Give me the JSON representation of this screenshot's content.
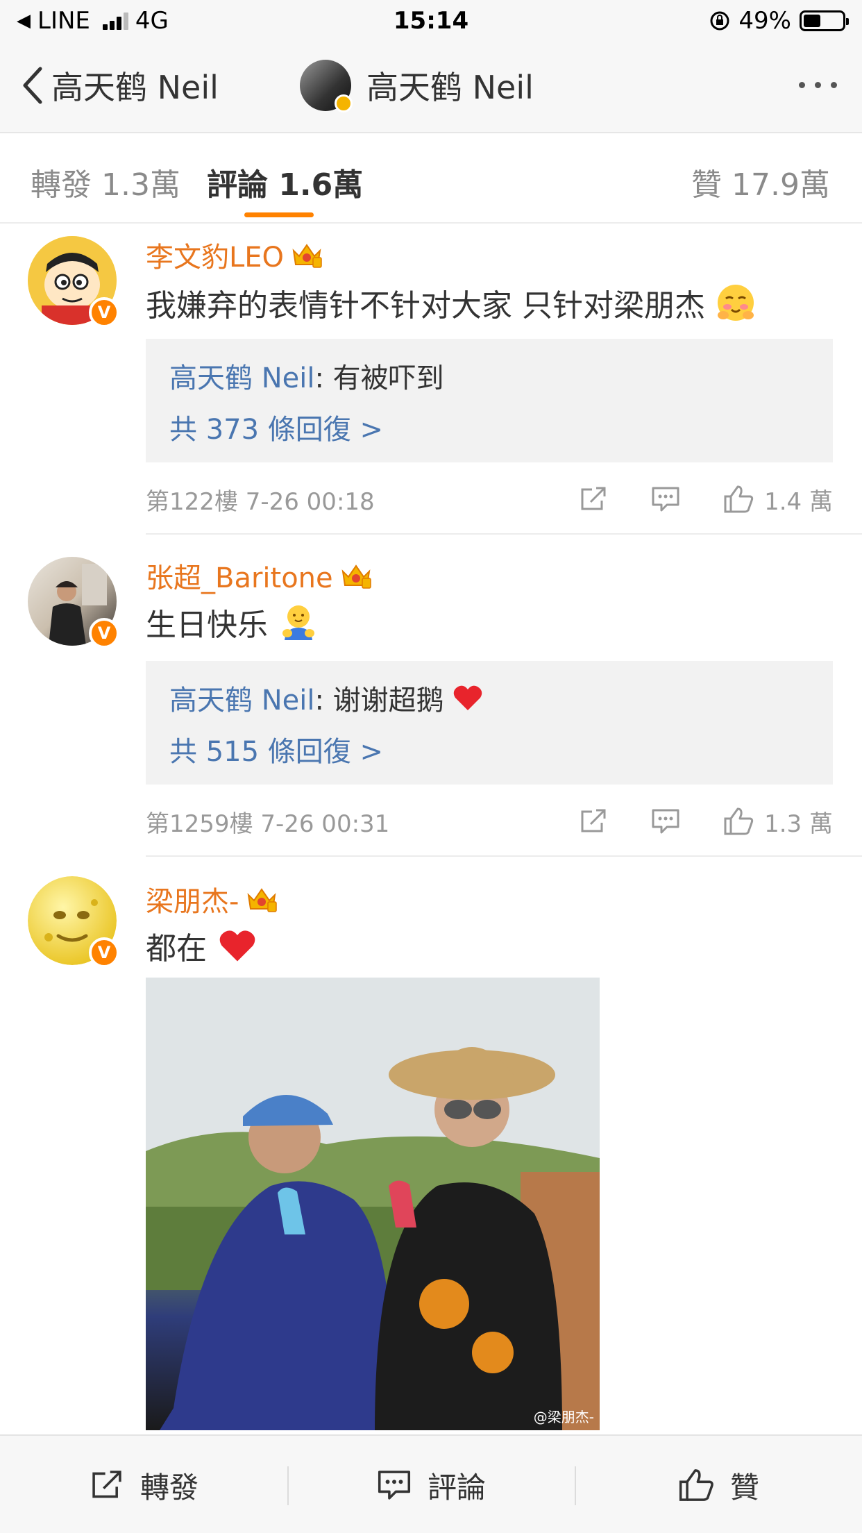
{
  "status_bar": {
    "carrier": "LINE",
    "network": "4G",
    "time": "15:14",
    "battery": "49%"
  },
  "nav": {
    "back_label": "高天鹤 Neil",
    "title": "高天鹤 Neil"
  },
  "tabs": {
    "repost": "轉發 1.3萬",
    "comments": "評論 1.6萬",
    "likes": "贊 17.9萬"
  },
  "comments": [
    {
      "user": "李文豹LEO",
      "text": "我嫌弃的表情针不针对大家 只针对梁朋杰",
      "reply_author": "高天鹤 Neil",
      "reply_text": ": 有被吓到",
      "reply_more": "共 373 條回復 >",
      "floor": "第122樓 7-26 00:18",
      "likes": "1.4 萬"
    },
    {
      "user": "张超_Baritone",
      "text": "生日快乐",
      "reply_author": "高天鹤 Neil",
      "reply_text": ": 谢谢超鹅",
      "reply_more": "共 515 條回復 >",
      "floor": "第1259樓 7-26 00:31",
      "likes": "1.3 萬"
    },
    {
      "user": "梁朋杰-",
      "text": "都在",
      "watermark": "@梁朋杰-"
    }
  ],
  "toolbar": {
    "repost": "轉發",
    "comment": "評論",
    "like": "贊"
  },
  "colors": {
    "accent": "#ff8200",
    "username": "#e8761e",
    "link": "#4a76b0"
  }
}
